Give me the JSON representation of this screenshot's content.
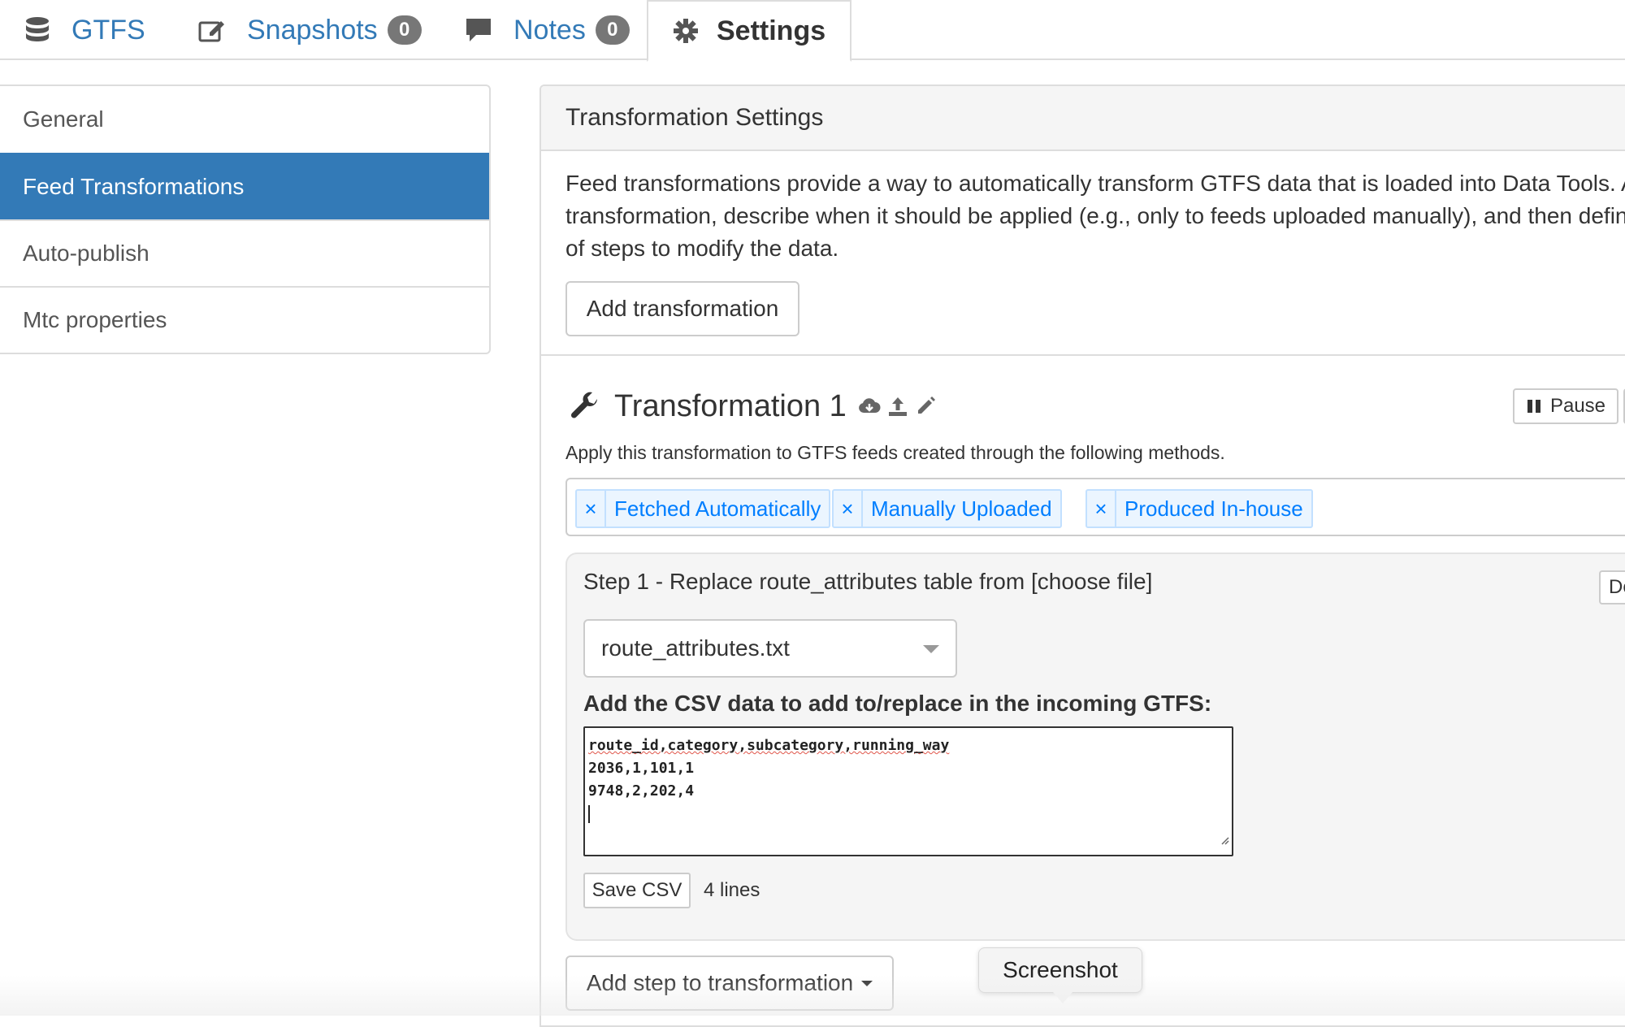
{
  "tabs": [
    {
      "label": "GTFS",
      "icon": "database-icon"
    },
    {
      "label": "Snapshots",
      "badge": "0",
      "icon": "edit-icon"
    },
    {
      "label": "Notes",
      "badge": "0",
      "icon": "comment-icon"
    },
    {
      "label": "Settings",
      "icon": "gear-icon",
      "active": true
    }
  ],
  "sidebar": {
    "items": [
      {
        "label": "General"
      },
      {
        "label": "Feed Transformations",
        "active": true
      },
      {
        "label": "Auto-publish"
      },
      {
        "label": "Mtc properties"
      }
    ]
  },
  "panel": {
    "heading": "Transformation Settings",
    "intro_lines": [
      "Feed transformations provide a way to automatically transform GTFS data that is loaded into Data Tools. A",
      "transformation, describe when it should be applied (e.g., only to feeds uploaded manually), and then define",
      "of steps to modify the data."
    ],
    "add_transformation_label": "Add transformation"
  },
  "transformation": {
    "title": "Transformation 1",
    "pause_label": "Pause",
    "apply_text": "Apply this transformation to GTFS feeds created through the following methods.",
    "methods": [
      "Fetched Automatically",
      "Manually Uploaded",
      "Produced In-house"
    ],
    "remove_glyph": "×",
    "step": {
      "title": "Step 1 - Replace route_attributes table from [choose file]",
      "delete_label": "De",
      "table_select": "route_attributes.txt",
      "csv_label": "Add the CSV data to add to/replace in the incoming GTFS:",
      "csv_lines": [
        "route_id,category,subcategory,running_way",
        "2036,1,101,1",
        "9748,2,202,4"
      ],
      "save_csv_label": "Save CSV",
      "lines_count": "4 lines"
    },
    "add_step_label": "Add step to transformation"
  },
  "tooltip": {
    "text": "Screenshot"
  },
  "colors": {
    "accent": "#337ab7",
    "tag_text": "#007eff",
    "tag_bg": "#ebf5ff",
    "badge": "#777777"
  }
}
